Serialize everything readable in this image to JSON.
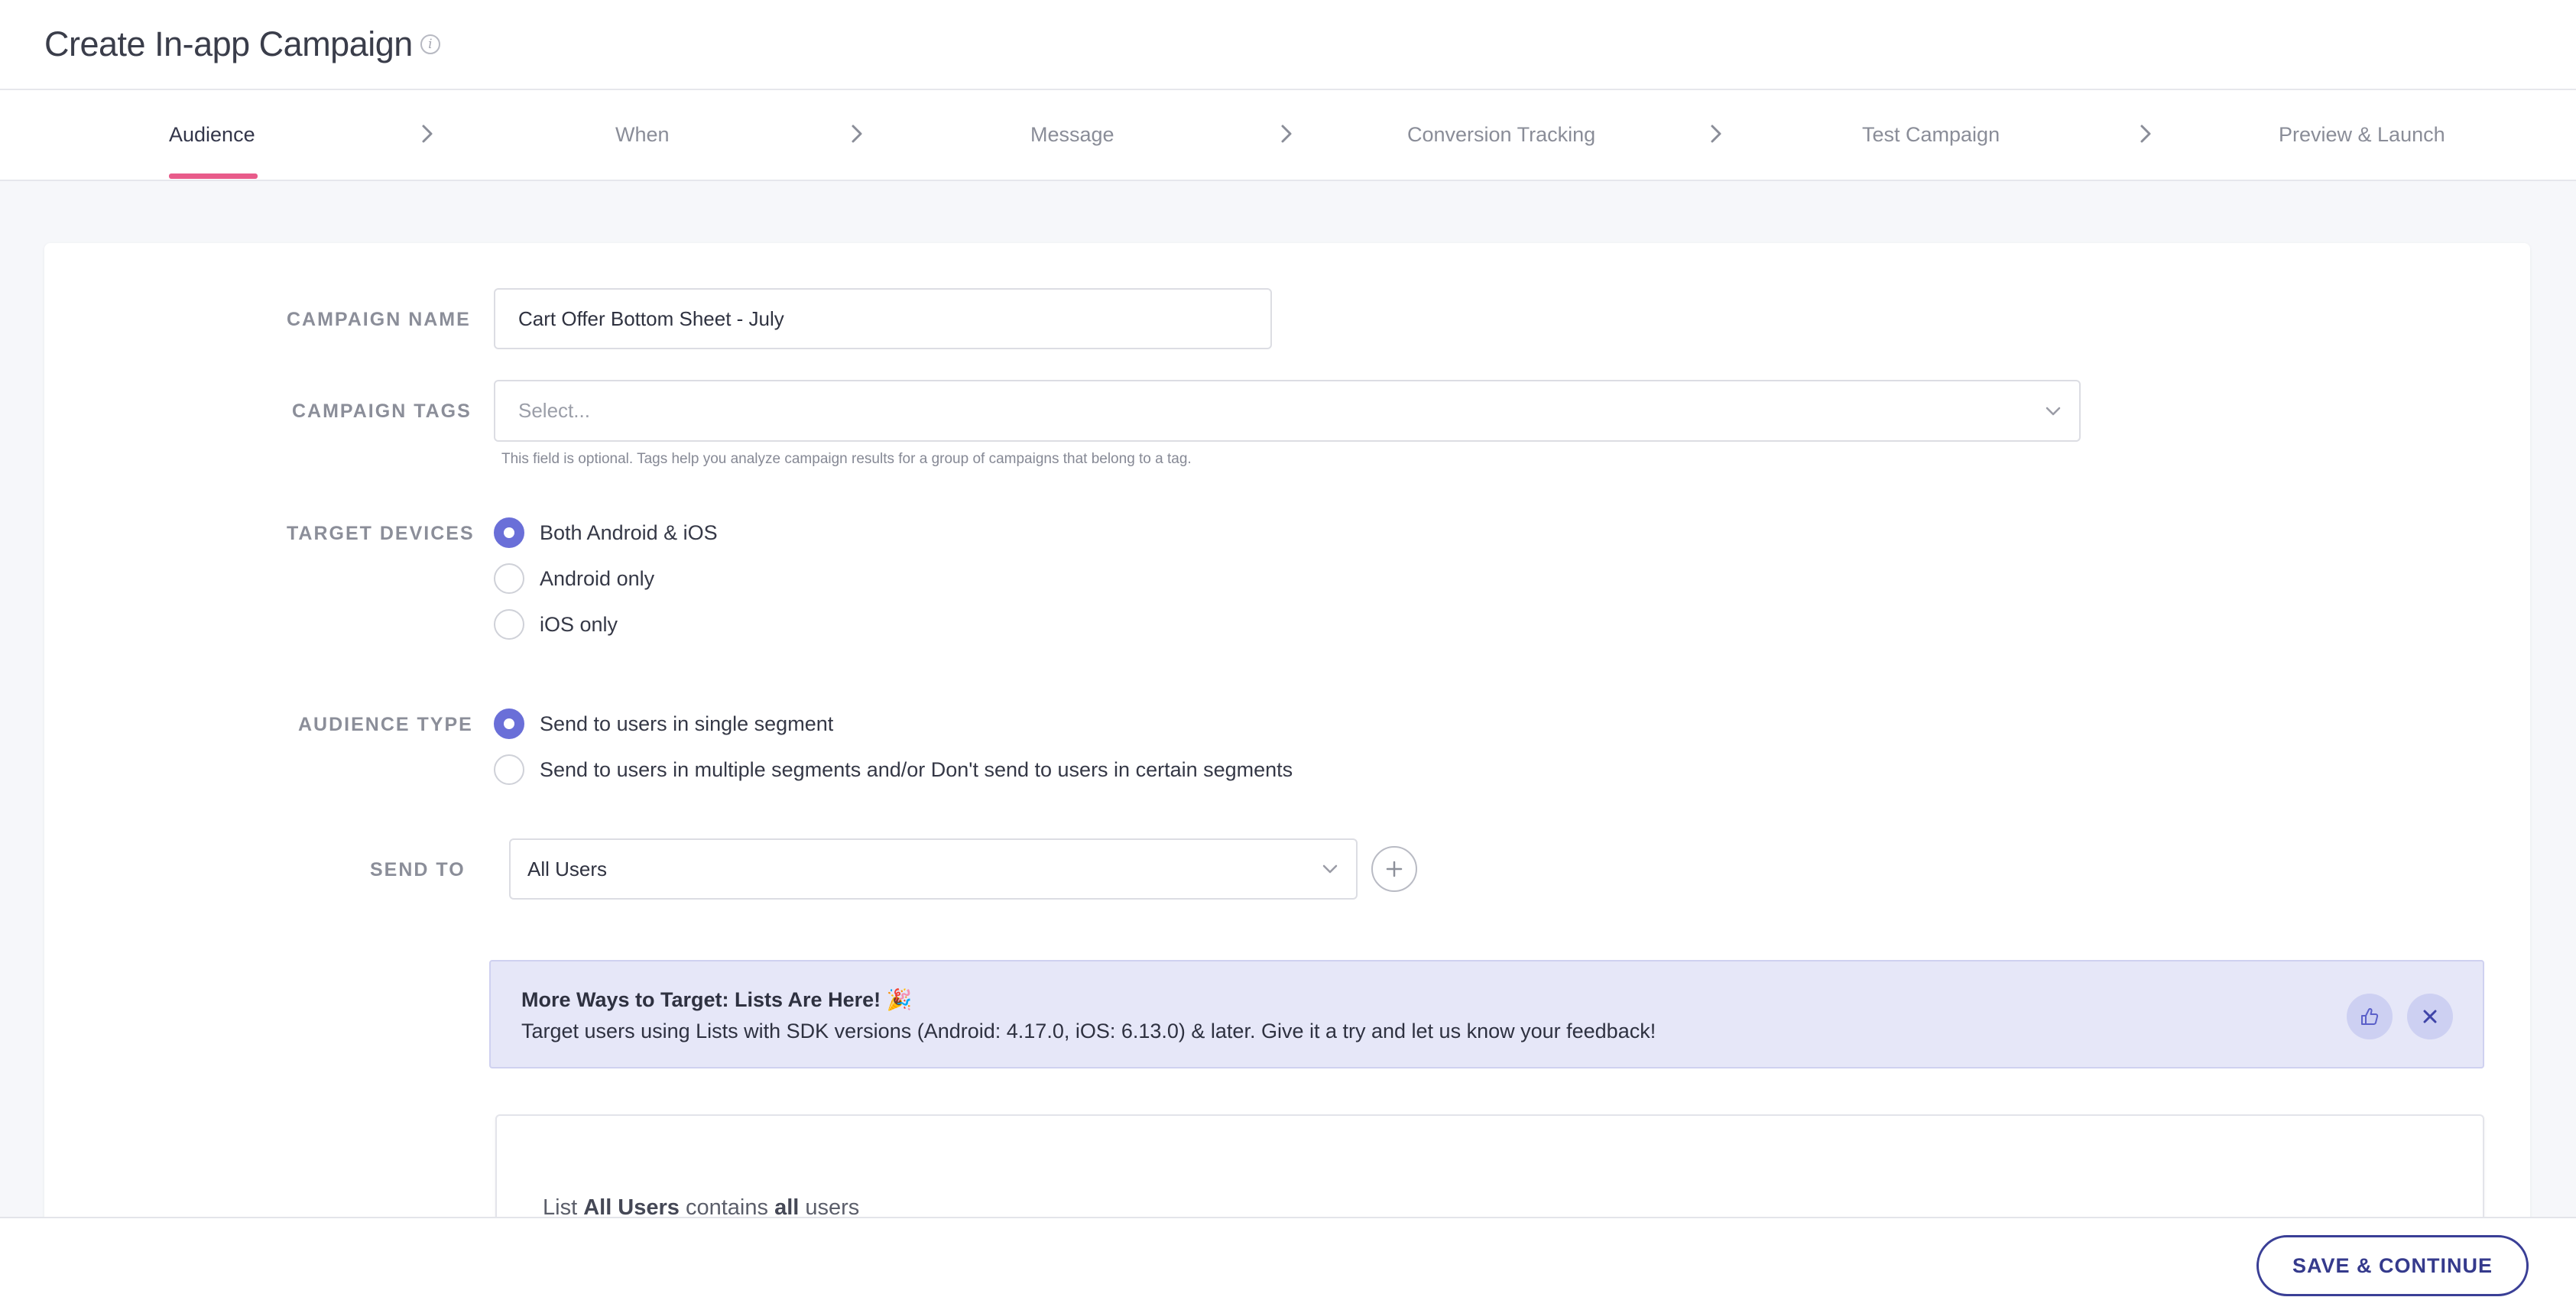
{
  "header": {
    "title": "Create In-app Campaign",
    "info_icon": "info-circle-icon"
  },
  "stepper": {
    "steps": [
      {
        "label": "Audience",
        "active": true
      },
      {
        "label": "When",
        "active": false
      },
      {
        "label": "Message",
        "active": false
      },
      {
        "label": "Conversion Tracking",
        "active": false
      },
      {
        "label": "Test Campaign",
        "active": false
      },
      {
        "label": "Preview & Launch",
        "active": false
      }
    ],
    "active_color": "#e85b8a"
  },
  "form": {
    "campaign_name": {
      "label": "CAMPAIGN NAME",
      "value": "Cart Offer Bottom Sheet - July"
    },
    "campaign_tags": {
      "label": "CAMPAIGN TAGS",
      "placeholder": "Select...",
      "help": "This field is optional. Tags help you analyze campaign results for a group of campaigns that belong to a tag."
    },
    "target_devices": {
      "label": "TARGET DEVICES",
      "options": [
        {
          "label": "Both Android & iOS",
          "checked": true
        },
        {
          "label": "Android only",
          "checked": false
        },
        {
          "label": "iOS only",
          "checked": false
        }
      ]
    },
    "audience_type": {
      "label": "AUDIENCE TYPE",
      "options": [
        {
          "label": "Send to users in single segment",
          "checked": true
        },
        {
          "label": "Send to users in multiple segments and/or Don't send to users in certain segments",
          "checked": false
        }
      ]
    },
    "send_to": {
      "label": "SEND TO",
      "value": "All Users"
    }
  },
  "banner": {
    "title": "More Ways to Target: Lists Are Here! 🎉",
    "body": "Target users using Lists with SDK versions (Android: 4.17.0, iOS: 6.13.0) & later. Give it a try and let us know your feedback!",
    "feedback_icon": "thumbs-up-icon",
    "close_icon": "close-icon"
  },
  "list_summary": {
    "prefix": "List ",
    "list_name": "All Users",
    "middle": " contains ",
    "quantifier": "all",
    "suffix": " users"
  },
  "footer": {
    "save_label": "SAVE & CONTINUE"
  },
  "colors": {
    "accent": "#6a6fd8",
    "primary_button": "#3a3f96",
    "banner_bg": "#e6e7f8"
  }
}
